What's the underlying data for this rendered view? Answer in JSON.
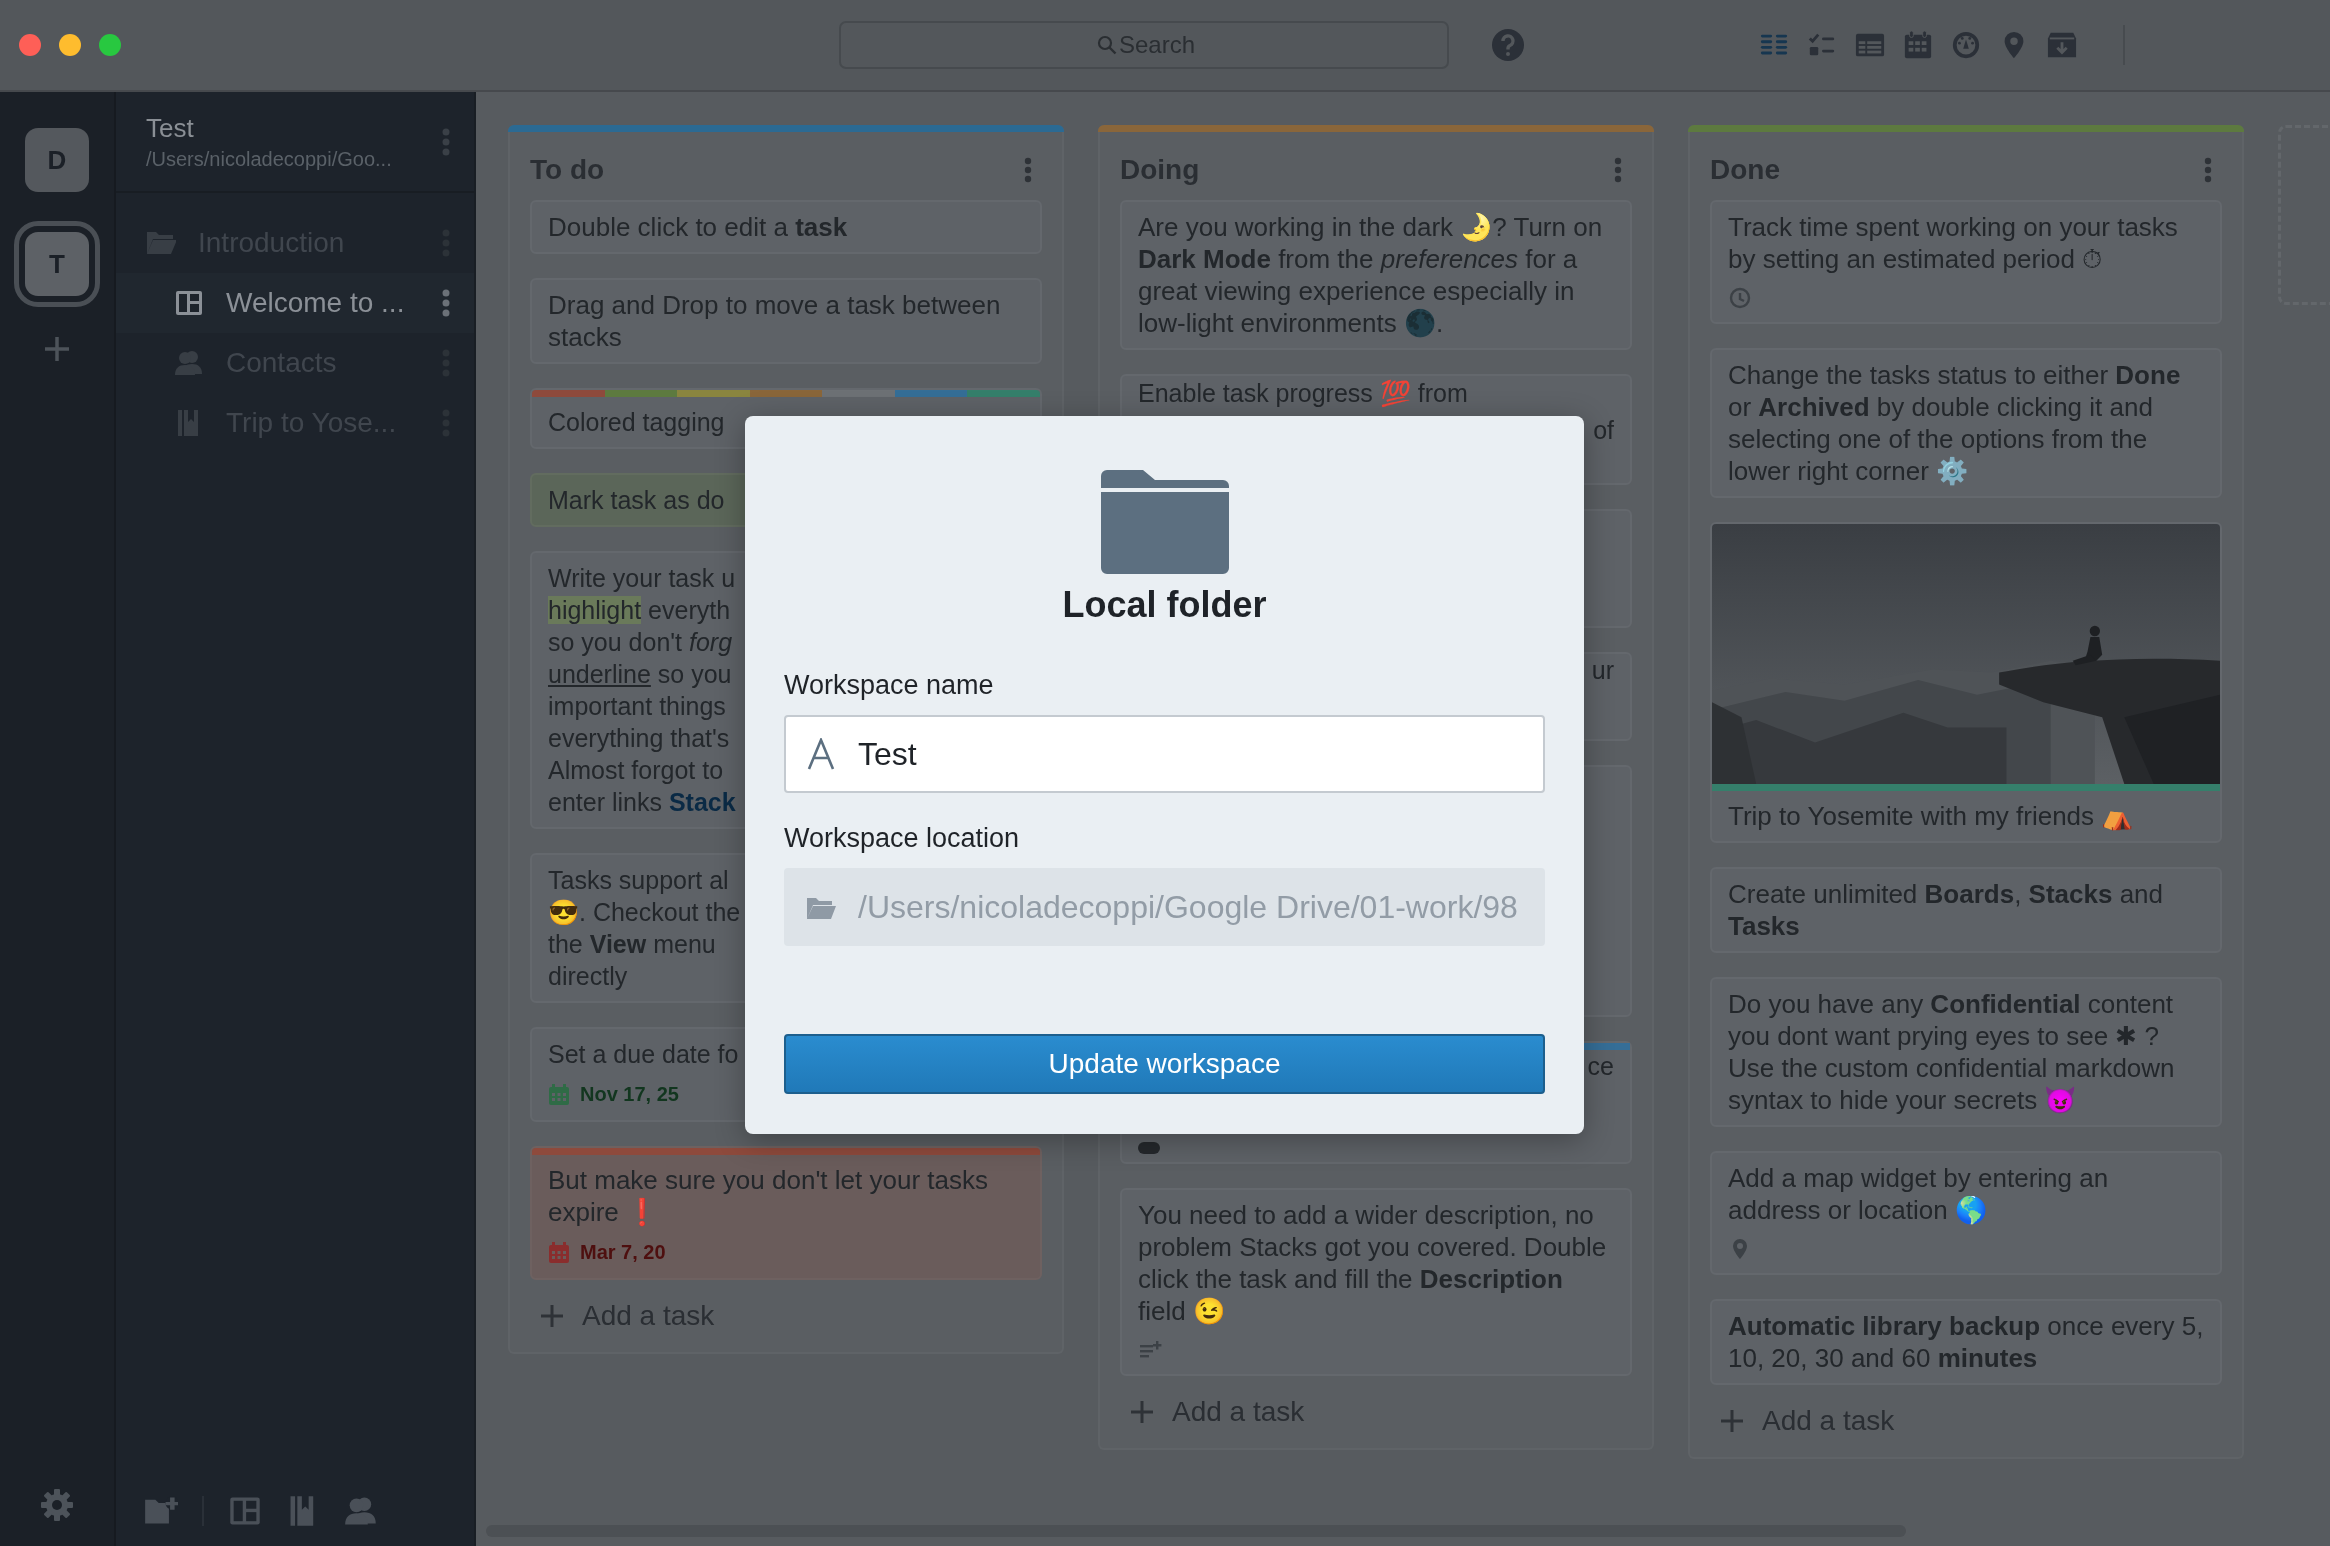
{
  "toolbar": {
    "search": {
      "placeholder": "Search"
    },
    "views": [
      {
        "kind": "list",
        "selected": true
      },
      {
        "kind": "checklist",
        "selected": false
      },
      {
        "kind": "table",
        "selected": false
      },
      {
        "kind": "calendar",
        "selected": false
      },
      {
        "kind": "dashboard",
        "selected": false
      },
      {
        "kind": "pin",
        "selected": false
      },
      {
        "kind": "archive",
        "selected": false
      }
    ]
  },
  "rail": {
    "workspaces": [
      {
        "label": "D",
        "selected": false
      },
      {
        "label": "T",
        "selected": true
      }
    ]
  },
  "sidebar": {
    "title": "Test",
    "path": "/Users/nicoladecoppi/Goo...",
    "items": [
      {
        "kind": "folder",
        "label": "Introduction",
        "expanded": true,
        "children": [
          {
            "kind": "board",
            "label": "Welcome to ...",
            "selected": true
          },
          {
            "kind": "contacts",
            "label": "Contacts",
            "selected": false
          },
          {
            "kind": "notebook",
            "label": "Trip to Yose...",
            "selected": false
          }
        ]
      }
    ],
    "footer": [
      {
        "kind": "folder-plus"
      },
      {
        "kind": "board"
      },
      {
        "kind": "notebook"
      },
      {
        "kind": "contacts"
      }
    ]
  },
  "board": {
    "stacks": [
      {
        "title": "To do",
        "color": "#2b6a93",
        "add_label": "Add a task",
        "cards": [
          {
            "text": "Double click to edit a **task**"
          },
          {
            "text": "Drag and Drop to move a task between stacks"
          },
          {
            "tags": [
              {
                "color": "#8e4a3c"
              },
              {
                "color": "#5d7a3f"
              },
              {
                "color": "#8a853f"
              },
              {
                "color": "#8a663a"
              },
              {
                "color": "#6d7175"
              },
              {
                "color": "#356e97"
              },
              {
                "color": "#357f6b"
              }
            ],
            "lines": [
              "Colored tagging"
            ]
          },
          {
            "done": true,
            "lines": [
              "Mark task as do"
            ]
          },
          {
            "lines": [
              "Write your task u",
              [
                {
                  "text": "highlight",
                  "kind": "highlight"
                },
                {
                  "text": " everyth"
                }
              ],
              [
                {
                  "text": "so you don't "
                },
                {
                  "text": "forg",
                  "kind": "italic"
                }
              ],
              [
                {
                  "text": "underline",
                  "kind": "underline"
                },
                {
                  "text": " so you"
                }
              ],
              "important things",
              "everything that's",
              "Almost forgot to",
              [
                {
                  "text": "enter links "
                },
                {
                  "text": "Stack",
                  "kind": "link"
                }
              ]
            ]
          },
          {
            "lines": [
              "Tasks support al",
              "😎. Checkout the",
              [
                {
                  "text": "the "
                },
                {
                  "text": "View",
                  "kind": "bold"
                },
                {
                  "text": " menu"
                }
              ],
              "directly"
            ]
          },
          {
            "lines": [
              "Set a due date fo"
            ],
            "due": {
              "label": "Nov 17, 25",
              "overdue": false
            }
          },
          {
            "expired": true,
            "tags": [
              {
                "color": "#8e4a3c"
              }
            ],
            "text": "But make sure you don't let your tasks expire ❗",
            "due": {
              "label": "Mar 7, 20",
              "overdue": true
            }
          }
        ]
      },
      {
        "title": "Doing",
        "color": "#8a663a",
        "add_label": "Add a task",
        "cards": [
          {
            "text": "Are you working in the dark 🌛? Turn on **Dark Mode** from the *preferences* for a great viewing experience especially in low-light environments 🌑."
          },
          {
            "kind": "covered",
            "lines": [
              "Enable task progress 💯 from"
            ],
            "tail": "of"
          },
          {
            "kind": "covered"
          },
          {
            "kind": "covered",
            "tail": "ur"
          },
          {
            "kind": "covered"
          },
          {
            "kind": "covered",
            "tags": [
              {
                "color": "#356e97"
              }
            ],
            "tail": "ce",
            "pill": true
          },
          {
            "text": "You need to add a wider description, no problem Stacks got you covered. Double click the task and fill the **Description** field 😉",
            "footer": {
              "kind": "description"
            }
          }
        ]
      },
      {
        "title": "Done",
        "color": "#5d7a3f",
        "add_label": "Add a task",
        "cards": [
          {
            "text": "Track time spent working on your tasks by setting an estimated period ⏱",
            "footer": {
              "kind": "clock"
            }
          },
          {
            "text": "Change the tasks status to either **Done** or **Archived** by double clicking it and selecting one of the options from the lower right corner ⚙️"
          },
          {
            "cover": {
              "kind": "picture"
            },
            "tags": [
              {
                "color": "#357f6b"
              }
            ],
            "text": "Trip to Yosemite with my friends ⛺"
          },
          {
            "text": "Create unlimited **Boards**, **Stacks** and **Tasks**"
          },
          {
            "text": "Do you have any **Confidential** content you dont want prying eyes to see  ✱ ? Use the custom confidential markdown syntax to hide your secrets 😈"
          },
          {
            "text": "Add a map widget by entering an address or location 🌎",
            "footer": {
              "kind": "pin"
            }
          },
          {
            "text": "**Automatic library backup** once every 5, 10, 20, 30 and 60 **minutes**"
          }
        ]
      }
    ]
  },
  "modal": {
    "title": "Local folder",
    "fields": [
      {
        "label": "Workspace name",
        "kind": "name",
        "value": "Test",
        "disabled": false
      },
      {
        "label": "Workspace location",
        "kind": "folder",
        "value": "/Users/nicoladecoppi/Google Drive/01-work/98",
        "disabled": true
      }
    ],
    "button": "Update workspace"
  }
}
